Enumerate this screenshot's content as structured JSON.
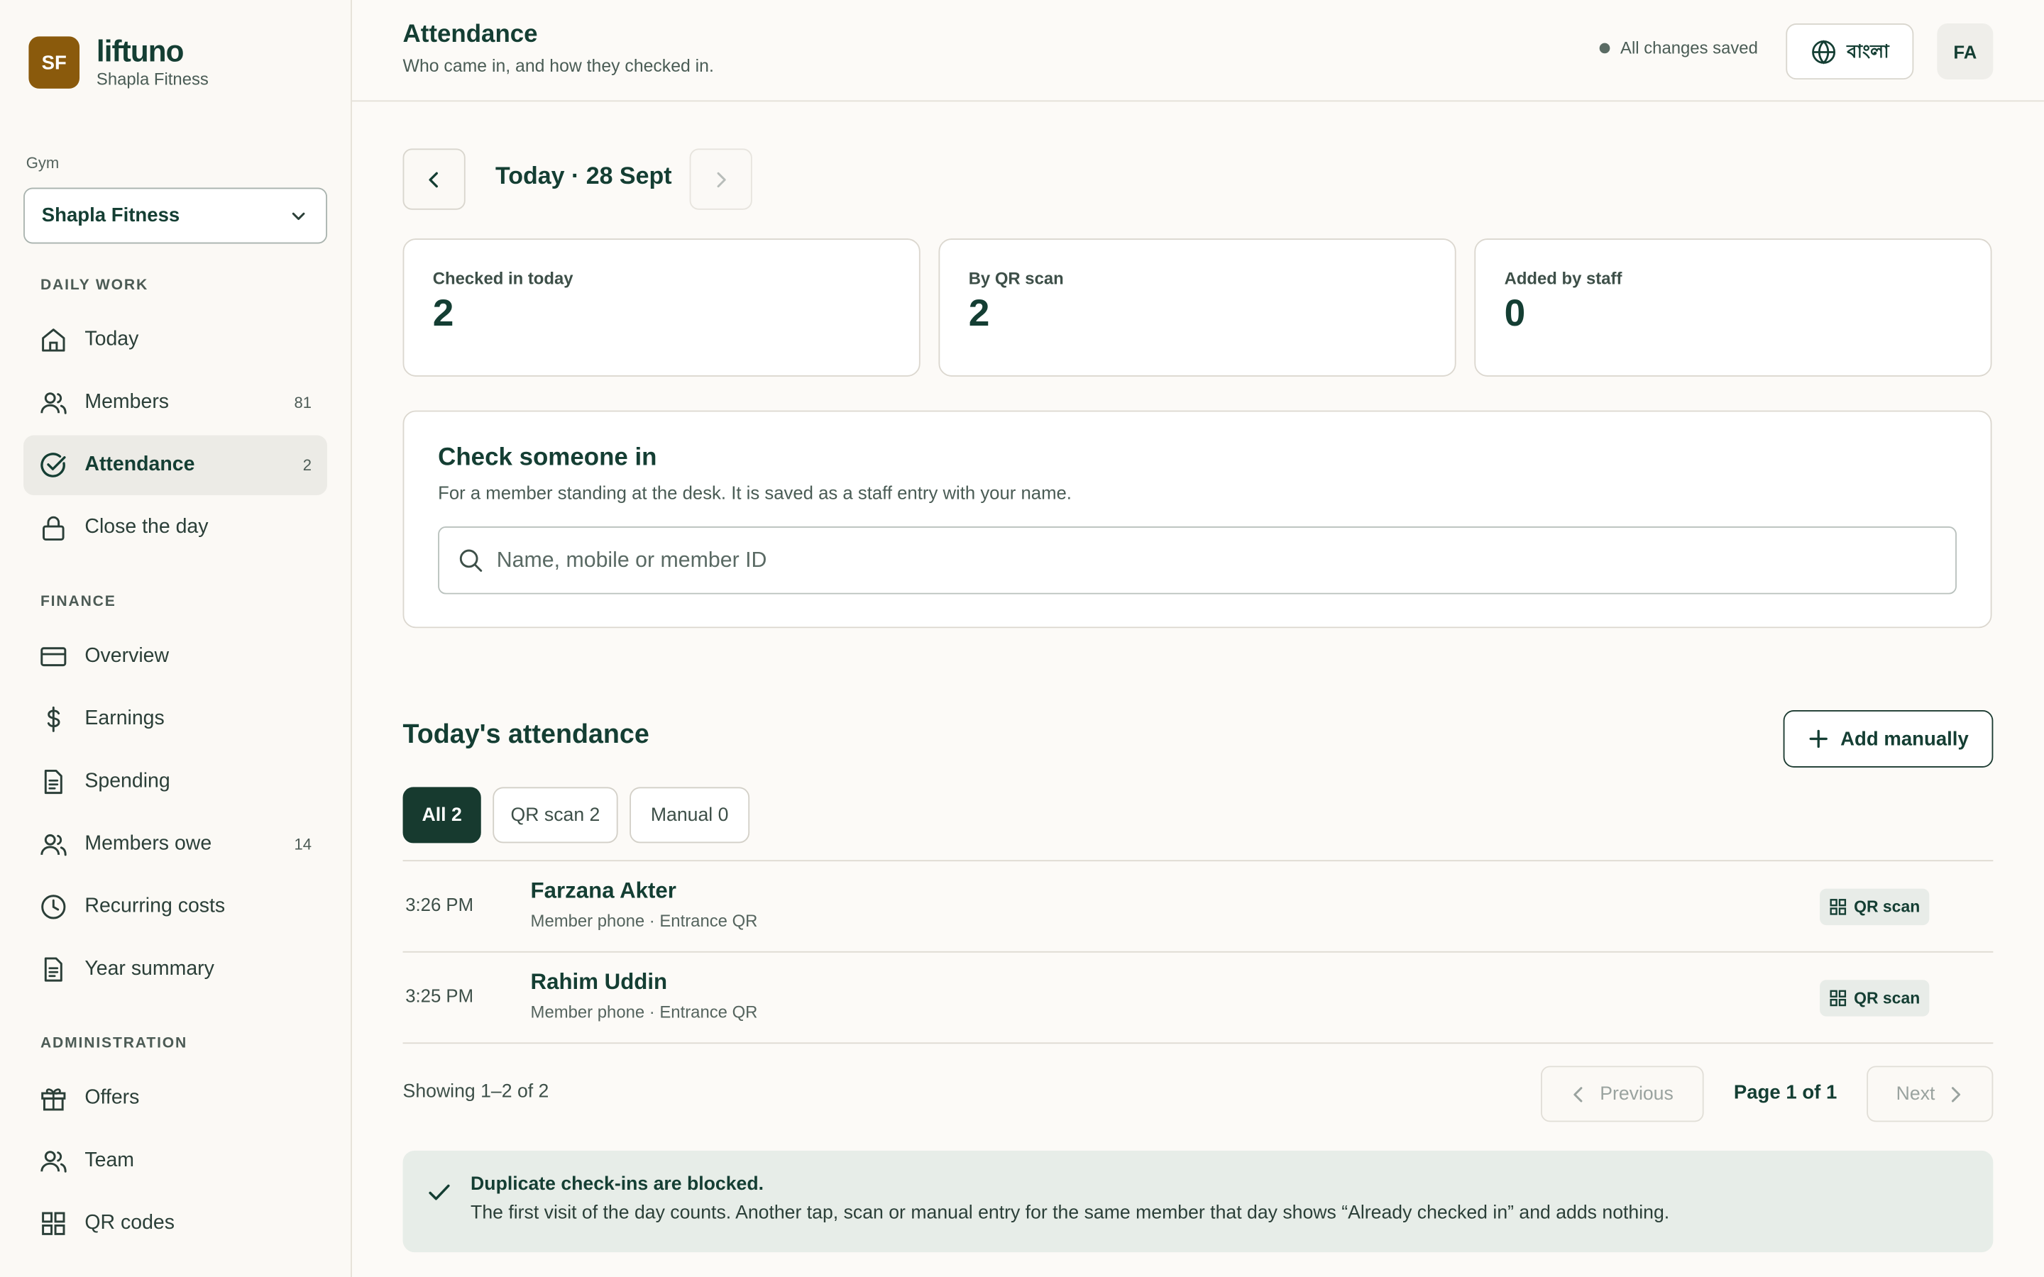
{
  "brand": {
    "initials": "SF",
    "name": "liftuno",
    "gym_name": "Shapla Fitness"
  },
  "gym_select": {
    "label": "Gym",
    "value": "Shapla Fitness"
  },
  "sidebar": {
    "sections": [
      {
        "label": "DAILY WORK",
        "items": [
          {
            "label": "Today",
            "icon": "home-icon",
            "count": ""
          },
          {
            "label": "Members",
            "icon": "users-icon",
            "count": "81"
          },
          {
            "label": "Attendance",
            "icon": "check-circle-icon",
            "count": "2",
            "active": true
          },
          {
            "label": "Close the day",
            "icon": "lock-icon",
            "count": ""
          }
        ]
      },
      {
        "label": "FINANCE",
        "items": [
          {
            "label": "Overview",
            "icon": "card-icon",
            "count": ""
          },
          {
            "label": "Earnings",
            "icon": "dollar-icon",
            "count": ""
          },
          {
            "label": "Spending",
            "icon": "document-icon",
            "count": ""
          },
          {
            "label": "Members owe",
            "icon": "users-icon",
            "count": "14"
          },
          {
            "label": "Recurring costs",
            "icon": "clock-icon",
            "count": ""
          },
          {
            "label": "Year summary",
            "icon": "document-icon",
            "count": ""
          }
        ]
      },
      {
        "label": "ADMINISTRATION",
        "items": [
          {
            "label": "Offers",
            "icon": "gift-icon",
            "count": ""
          },
          {
            "label": "Team",
            "icon": "users-icon",
            "count": ""
          },
          {
            "label": "QR codes",
            "icon": "grid-icon",
            "count": ""
          }
        ]
      }
    ]
  },
  "header": {
    "title": "Attendance",
    "subtitle": "Who came in, and how they checked in.",
    "save_status": "All changes saved",
    "language_label": "বাংলা",
    "user_initials": "FA"
  },
  "date_nav": {
    "label": "Today · 28 Sept"
  },
  "stats": [
    {
      "label": "Checked in today",
      "value": "2"
    },
    {
      "label": "By QR scan",
      "value": "2"
    },
    {
      "label": "Added by staff",
      "value": "0"
    }
  ],
  "checkin": {
    "title": "Check someone in",
    "subtitle": "For a member standing at the desk. It is saved as a staff entry with your name.",
    "placeholder": "Name, mobile or member ID"
  },
  "attendance": {
    "title": "Today's attendance",
    "add_label": "Add manually",
    "filters": [
      {
        "label": "All 2",
        "active": true
      },
      {
        "label": "QR scan 2",
        "active": false
      },
      {
        "label": "Manual 0",
        "active": false
      }
    ],
    "rows": [
      {
        "time": "3:26 PM",
        "name": "Farzana Akter",
        "meta": "Member phone · Entrance QR",
        "method": "QR scan"
      },
      {
        "time": "3:25 PM",
        "name": "Rahim Uddin",
        "meta": "Member phone · Entrance QR",
        "method": "QR scan"
      }
    ]
  },
  "pagination": {
    "showing": "Showing 1–2 of 2",
    "prev_label": "Previous",
    "page_label": "Page 1 of 1",
    "next_label": "Next"
  },
  "notice": {
    "title": "Duplicate check-ins are blocked.",
    "body": "The first visit of the day counts. Another tap, scan or manual entry for the same member that day shows “Already checked in” and adds nothing."
  },
  "colors": {
    "brand": "#8a5a0c",
    "primary": "#173a2f",
    "text": "#143e33",
    "notice_bg": "#e7ede8"
  }
}
